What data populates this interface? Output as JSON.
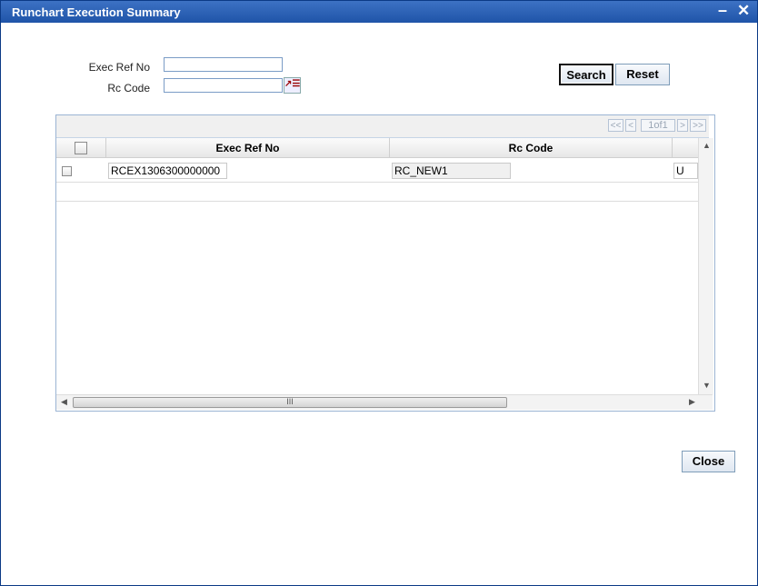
{
  "window": {
    "title": "Runchart Execution Summary",
    "minimize_glyph": "–",
    "close_glyph": "✕"
  },
  "form": {
    "exec_ref_label": "Exec Ref No",
    "exec_ref_value": "",
    "rc_code_label": "Rc Code",
    "rc_code_value": "",
    "lov_icon": "lov-icon"
  },
  "buttons": {
    "search": "Search",
    "reset": "Reset",
    "close": "Close"
  },
  "pager": {
    "first": "<<",
    "prev": "<",
    "page_text": "1of1",
    "next": ">",
    "last": ">>"
  },
  "table": {
    "columns": [
      "Exec Ref No",
      "Rc Code"
    ],
    "rows": [
      {
        "exec_ref_no": "RCEX1306300000000",
        "rc_code": "RC_NEW1",
        "extra": "U"
      }
    ]
  },
  "scrollbar": {
    "thumb_grip": "III"
  },
  "colors": {
    "titlebar": "#2a5fb2",
    "border": "#0b3a86"
  }
}
